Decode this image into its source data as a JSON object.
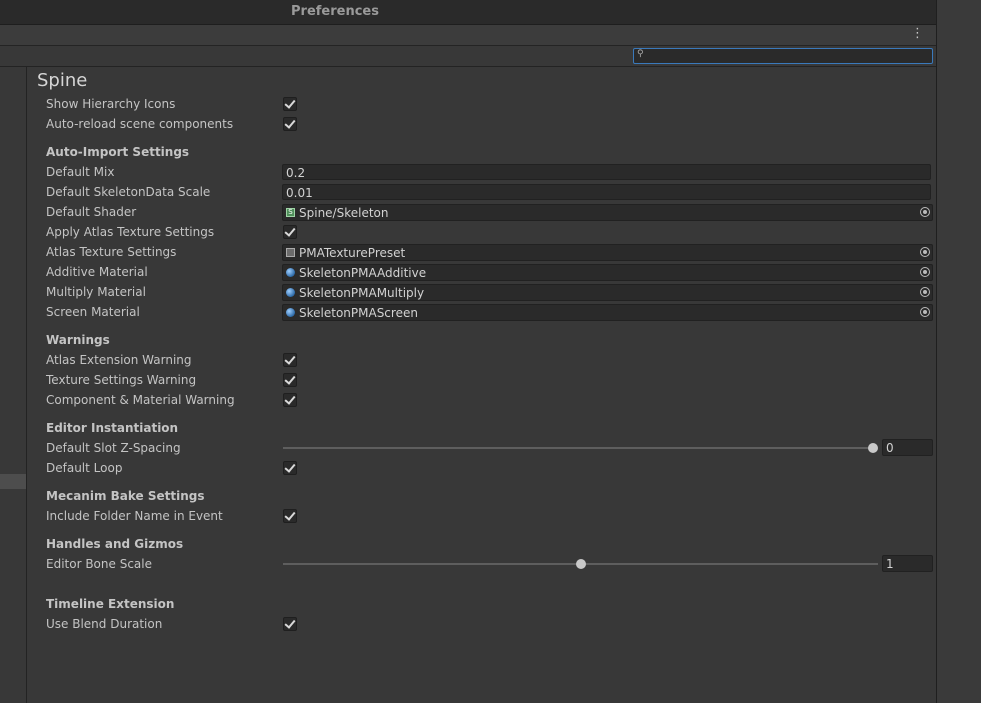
{
  "window": {
    "title": "Preferences"
  },
  "search": {
    "value": ""
  },
  "page": {
    "heading": "Spine"
  },
  "general": {
    "show_hierarchy_icons": {
      "label": "Show Hierarchy Icons",
      "checked": true
    },
    "auto_reload": {
      "label": "Auto-reload scene components",
      "checked": true
    }
  },
  "auto_import": {
    "header": "Auto-Import Settings",
    "default_mix": {
      "label": "Default Mix",
      "value": "0.2"
    },
    "default_scale": {
      "label": "Default SkeletonData Scale",
      "value": "0.01"
    },
    "default_shader": {
      "label": "Default Shader",
      "value": "Spine/Skeleton",
      "icon": "shader-icon"
    },
    "apply_atlas": {
      "label": "Apply Atlas Texture Settings",
      "checked": true
    },
    "atlas_texture": {
      "label": "Atlas Texture Settings",
      "value": "PMATexturePreset",
      "icon": "preset-icon"
    },
    "additive": {
      "label": "Additive Material",
      "value": "SkeletonPMAAdditive",
      "icon": "material-icon"
    },
    "multiply": {
      "label": "Multiply Material",
      "value": "SkeletonPMAMultiply",
      "icon": "material-icon"
    },
    "screen": {
      "label": "Screen Material",
      "value": "SkeletonPMAScreen",
      "icon": "material-icon"
    }
  },
  "warnings": {
    "header": "Warnings",
    "atlas_ext": {
      "label": "Atlas Extension Warning",
      "checked": true
    },
    "texture": {
      "label": "Texture Settings Warning",
      "checked": true
    },
    "component": {
      "label": "Component & Material Warning",
      "checked": true
    }
  },
  "editor_inst": {
    "header": "Editor Instantiation",
    "slot_z": {
      "label": "Default Slot Z-Spacing",
      "value": "0",
      "slider_fraction": 1.0
    },
    "loop": {
      "label": "Default Loop",
      "checked": true
    }
  },
  "mecanim": {
    "header": "Mecanim Bake Settings",
    "folder_name": {
      "label": "Include Folder Name in Event",
      "checked": true
    }
  },
  "handles": {
    "header": "Handles and Gizmos",
    "bone_scale": {
      "label": "Editor Bone Scale",
      "value": "1",
      "slider_fraction": 0.5
    }
  },
  "timeline": {
    "header": "Timeline Extension",
    "blend": {
      "label": "Use Blend Duration",
      "checked": true
    }
  },
  "colors": {
    "background": "#383838",
    "field": "#2a2a2a",
    "focus": "#3a79bb",
    "text": "#c4c4c4"
  }
}
